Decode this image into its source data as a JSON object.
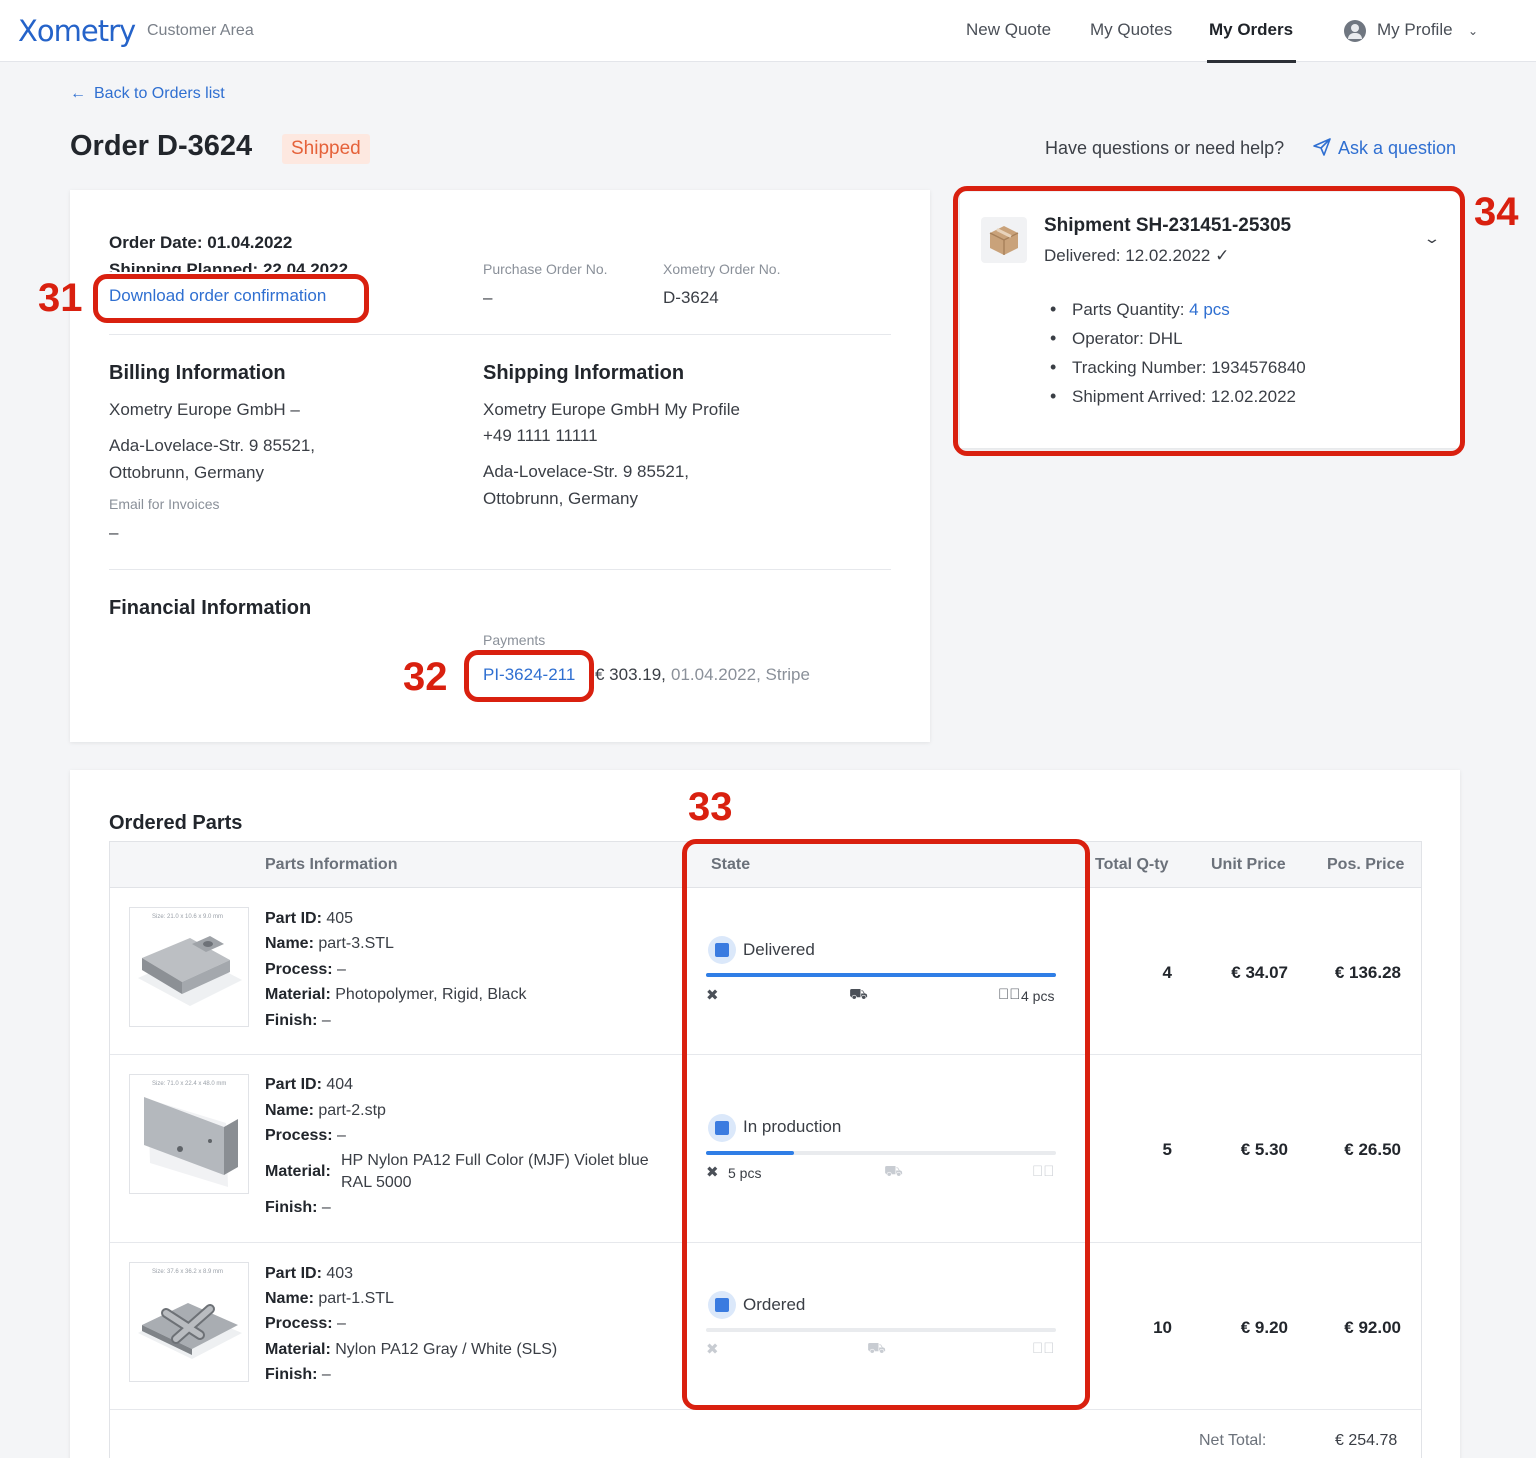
{
  "header": {
    "logo": "Xometry",
    "area": "Customer Area",
    "nav": [
      "New Quote",
      "My Quotes",
      "My Orders"
    ],
    "profile": "My Profile"
  },
  "back_link": "Back to Orders list",
  "order": {
    "title": "Order D-3624",
    "status": "Shipped",
    "help_text": "Have questions or need help?",
    "ask": "Ask a question",
    "order_date": "Order Date: 01.04.2022",
    "shipping_planned": "Shipping Planned: 22.04.2022",
    "download": "Download order confirmation",
    "po_label": "Purchase Order No.",
    "po_value": "–",
    "xo_label": "Xometry Order No.",
    "xo_value": "D-3624"
  },
  "billing": {
    "title": "Billing Information",
    "company": "Xometry Europe GmbH –",
    "addr1": "Ada-Lovelace-Str. 9 85521,",
    "addr2": "Ottobrunn, Germany",
    "email_label": "Email for Invoices",
    "email_value": "–"
  },
  "shipping": {
    "title": "Shipping Information",
    "company": "Xometry Europe GmbH My Profile",
    "phone": "+49 1111 11111",
    "addr1": "Ada-Lovelace-Str. 9 85521,",
    "addr2": "Ottobrunn, Germany"
  },
  "financial": {
    "title": "Financial Information",
    "payments_label": "Payments",
    "payment_id": "PI-3624-211",
    "amount": "€ 303.19,",
    "details": "01.04.2022, Stripe"
  },
  "shipment": {
    "title": "Shipment SH-231451-25305",
    "delivered": "Delivered: 12.02.2022",
    "check": "✓",
    "qty_label": "Parts Quantity:",
    "qty_value": "4 pcs",
    "operator": "Operator: DHL",
    "tracking": "Tracking Number: 1934576840",
    "arrived": "Shipment Arrived: 12.02.2022"
  },
  "annotations": [
    "31",
    "32",
    "33",
    "34"
  ],
  "parts": {
    "title": "Ordered Parts",
    "headers": [
      "Parts Information",
      "State",
      "Total Q-ty",
      "Unit Price",
      "Pos. Price"
    ],
    "field_labels": [
      "Part ID:",
      "Name:",
      "Process:",
      "Material:",
      "Finish:"
    ],
    "rows": [
      {
        "size": "Size: 21.0 x 10.6 x 9.0 mm",
        "id": "405",
        "name": "part-3.STL",
        "process": "–",
        "material": "Photopolymer, Rigid, Black",
        "finish": "–",
        "state": "Delivered",
        "progress": 1.0,
        "left_text": "",
        "right_text": "4 pcs",
        "qty": "4",
        "unit": "€ 34.07",
        "pos": "€ 136.28"
      },
      {
        "size": "Size: 71.0 x 22.4 x 48.0 mm",
        "id": "404",
        "name": "part-2.stp",
        "process": "–",
        "material_l1": "HP Nylon PA12 Full Color (MJF) Violet blue",
        "material_l2": "RAL 5000",
        "finish": "–",
        "state": "In production",
        "progress": 0.25,
        "left_text": "5 pcs",
        "right_text": "",
        "qty": "5",
        "unit": "€ 5.30",
        "pos": "€ 26.50"
      },
      {
        "size": "Size: 37.6 x 36.2 x 8.9 mm",
        "id": "403",
        "name": "part-1.STL",
        "process": "–",
        "material": "Nylon PA12 Gray / White (SLS)",
        "finish": "–",
        "state": "Ordered",
        "progress": 0.0,
        "left_text": "",
        "right_text": "",
        "qty": "10",
        "unit": "€ 9.20",
        "pos": "€ 92.00"
      }
    ],
    "net_total_label": "Net Total:",
    "net_total_value": "€ 254.78"
  },
  "colors": {
    "accent": "#2f6fd1",
    "annotation": "#d9200f",
    "badge_bg": "#fde8e0",
    "badge_text": "#e5623a"
  }
}
